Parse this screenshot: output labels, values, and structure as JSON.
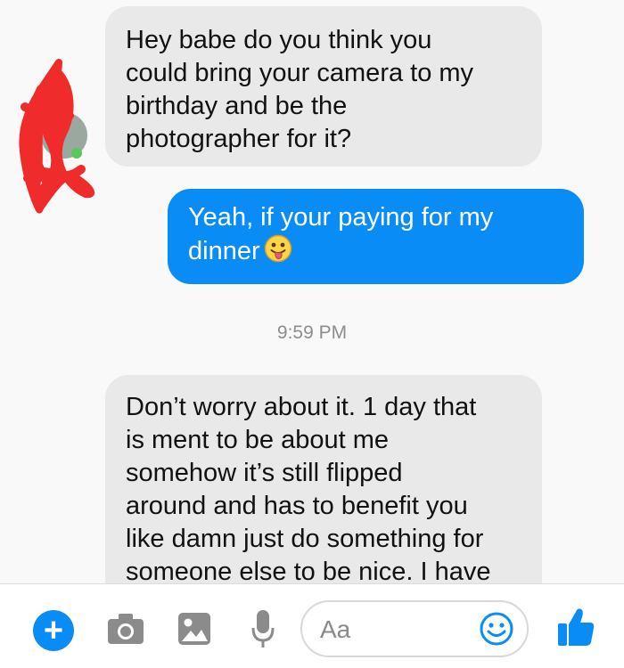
{
  "conversation": {
    "messages": [
      {
        "side": "incoming",
        "text": "Hey babe do you think you\ncould bring your camera to my\nbirthday and be the\nphotographer for it?"
      },
      {
        "side": "outgoing",
        "text": "Yeah, if your paying for my\ndinner",
        "emoji": "tongue-out-emoji"
      },
      {
        "side": "incoming",
        "text": "Don’t worry about it. 1 day that\nis ment to be about me\nsomehow it’s still flipped\naround and has to benefit you\nlike damn just do something for\nsomeone else to be nice. I have"
      }
    ],
    "timestamp": "9:59 PM",
    "avatar": "redacted-avatar"
  },
  "composer": {
    "placeholder": "Aa",
    "icons": [
      "plus-icon",
      "camera-icon",
      "image-icon",
      "microphone-icon",
      "emoji-icon",
      "like-thumb-icon"
    ],
    "accent_color": "#0a8cf6"
  }
}
